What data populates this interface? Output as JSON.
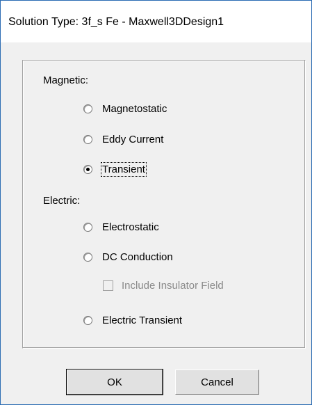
{
  "window": {
    "title": "Solution Type: 3f_s Fe - Maxwell3DDesign1"
  },
  "groups": {
    "magnetic_label": "Magnetic:",
    "electric_label": "Electric:"
  },
  "options": {
    "magnetostatic": {
      "label": "Magnetostatic",
      "selected": false
    },
    "eddy_current": {
      "label": "Eddy Current",
      "selected": false
    },
    "transient": {
      "label": "Transient",
      "selected": true
    },
    "electrostatic": {
      "label": "Electrostatic",
      "selected": false
    },
    "dc_conduction": {
      "label": "DC Conduction",
      "selected": false
    },
    "include_insulator_field": {
      "label": "Include Insulator Field",
      "checked": false,
      "enabled": false
    },
    "electric_transient": {
      "label": "Electric Transient",
      "selected": false
    }
  },
  "buttons": {
    "ok_label": "OK",
    "cancel_label": "Cancel"
  }
}
